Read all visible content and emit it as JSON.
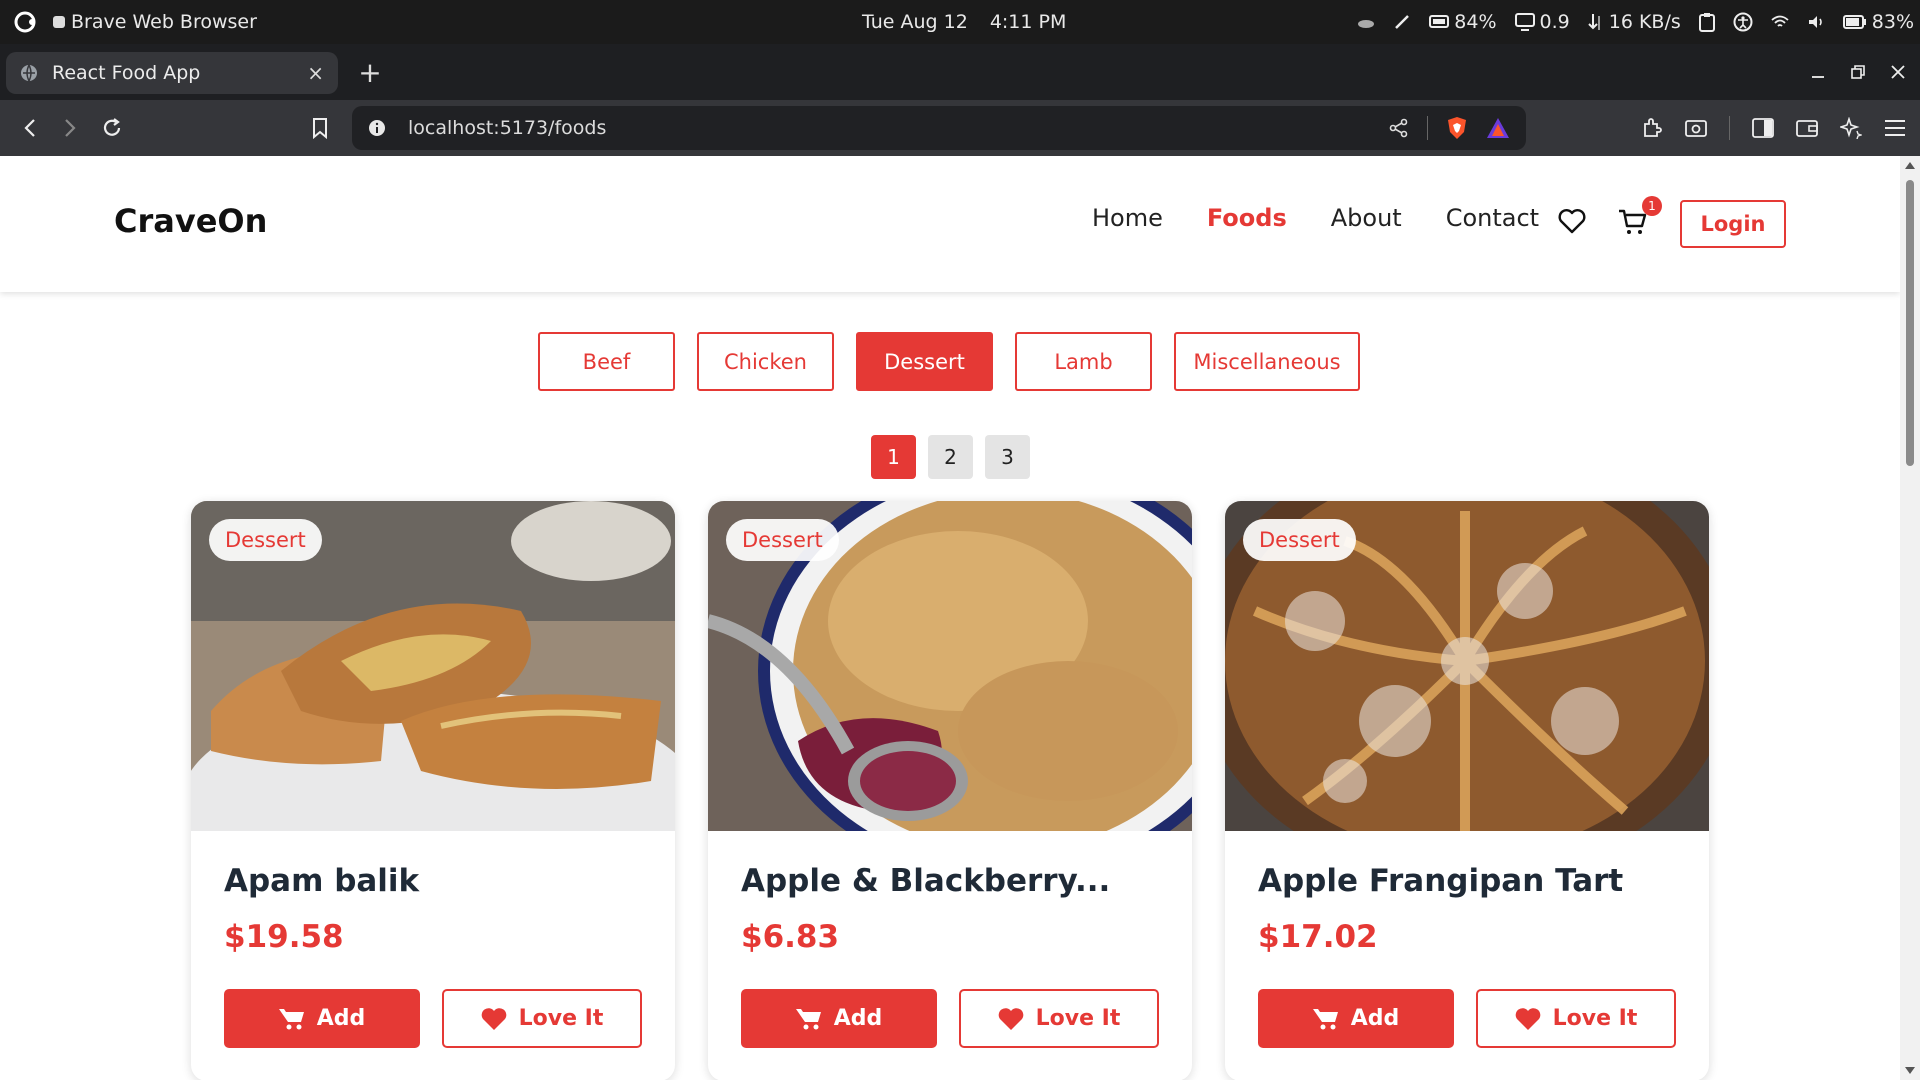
{
  "os": {
    "app_name": "Brave Web Browser",
    "date": "Tue Aug 12",
    "time": "4:11 PM",
    "cpu": "84%",
    "load": "0.9",
    "net": "16 KB/s",
    "battery": "83%"
  },
  "browser": {
    "tab_title": "React Food App",
    "tab_close": "×",
    "new_tab": "+",
    "url": "localhost:5173/foods"
  },
  "site": {
    "logo": "CraveOn",
    "nav": [
      "Home",
      "Foods",
      "About",
      "Contact"
    ],
    "active_nav": "Foods",
    "cart_count": "1",
    "login": "Login"
  },
  "categories": [
    "Beef",
    "Chicken",
    "Dessert",
    "Lamb",
    "Miscellaneous"
  ],
  "active_category": "Dessert",
  "pages": [
    "1",
    "2",
    "3"
  ],
  "active_page": "1",
  "cards": [
    {
      "tag": "Dessert",
      "title": "Apam balik",
      "price": "$19.58",
      "add": "Add",
      "love": "Love It"
    },
    {
      "tag": "Dessert",
      "title": "Apple & Blackberry...",
      "price": "$6.83",
      "add": "Add",
      "love": "Love It"
    },
    {
      "tag": "Dessert",
      "title": "Apple Frangipan Tart",
      "price": "$17.02",
      "add": "Add",
      "love": "Love It"
    }
  ],
  "colors": {
    "accent": "#e53935",
    "title": "#1f2a37"
  },
  "icons": {
    "os": [
      "ubuntu-logo-icon",
      "brave-app-icon",
      "cloud-icon",
      "pen-icon",
      "cpu-icon",
      "monitor-icon",
      "network-icon",
      "clipboard-icon",
      "accessibility-icon",
      "wifi-icon",
      "volume-icon",
      "battery-icon"
    ],
    "browser": [
      "back-icon",
      "forward-icon",
      "reload-icon",
      "bookmark-icon",
      "info-icon",
      "share-icon",
      "brave-shield-icon",
      "brave-rewards-icon",
      "extensions-icon",
      "screenshot-icon",
      "sidebar-icon",
      "wallet-icon",
      "leo-icon",
      "menu-icon"
    ],
    "site": [
      "heart-icon",
      "cart-icon"
    ]
  }
}
